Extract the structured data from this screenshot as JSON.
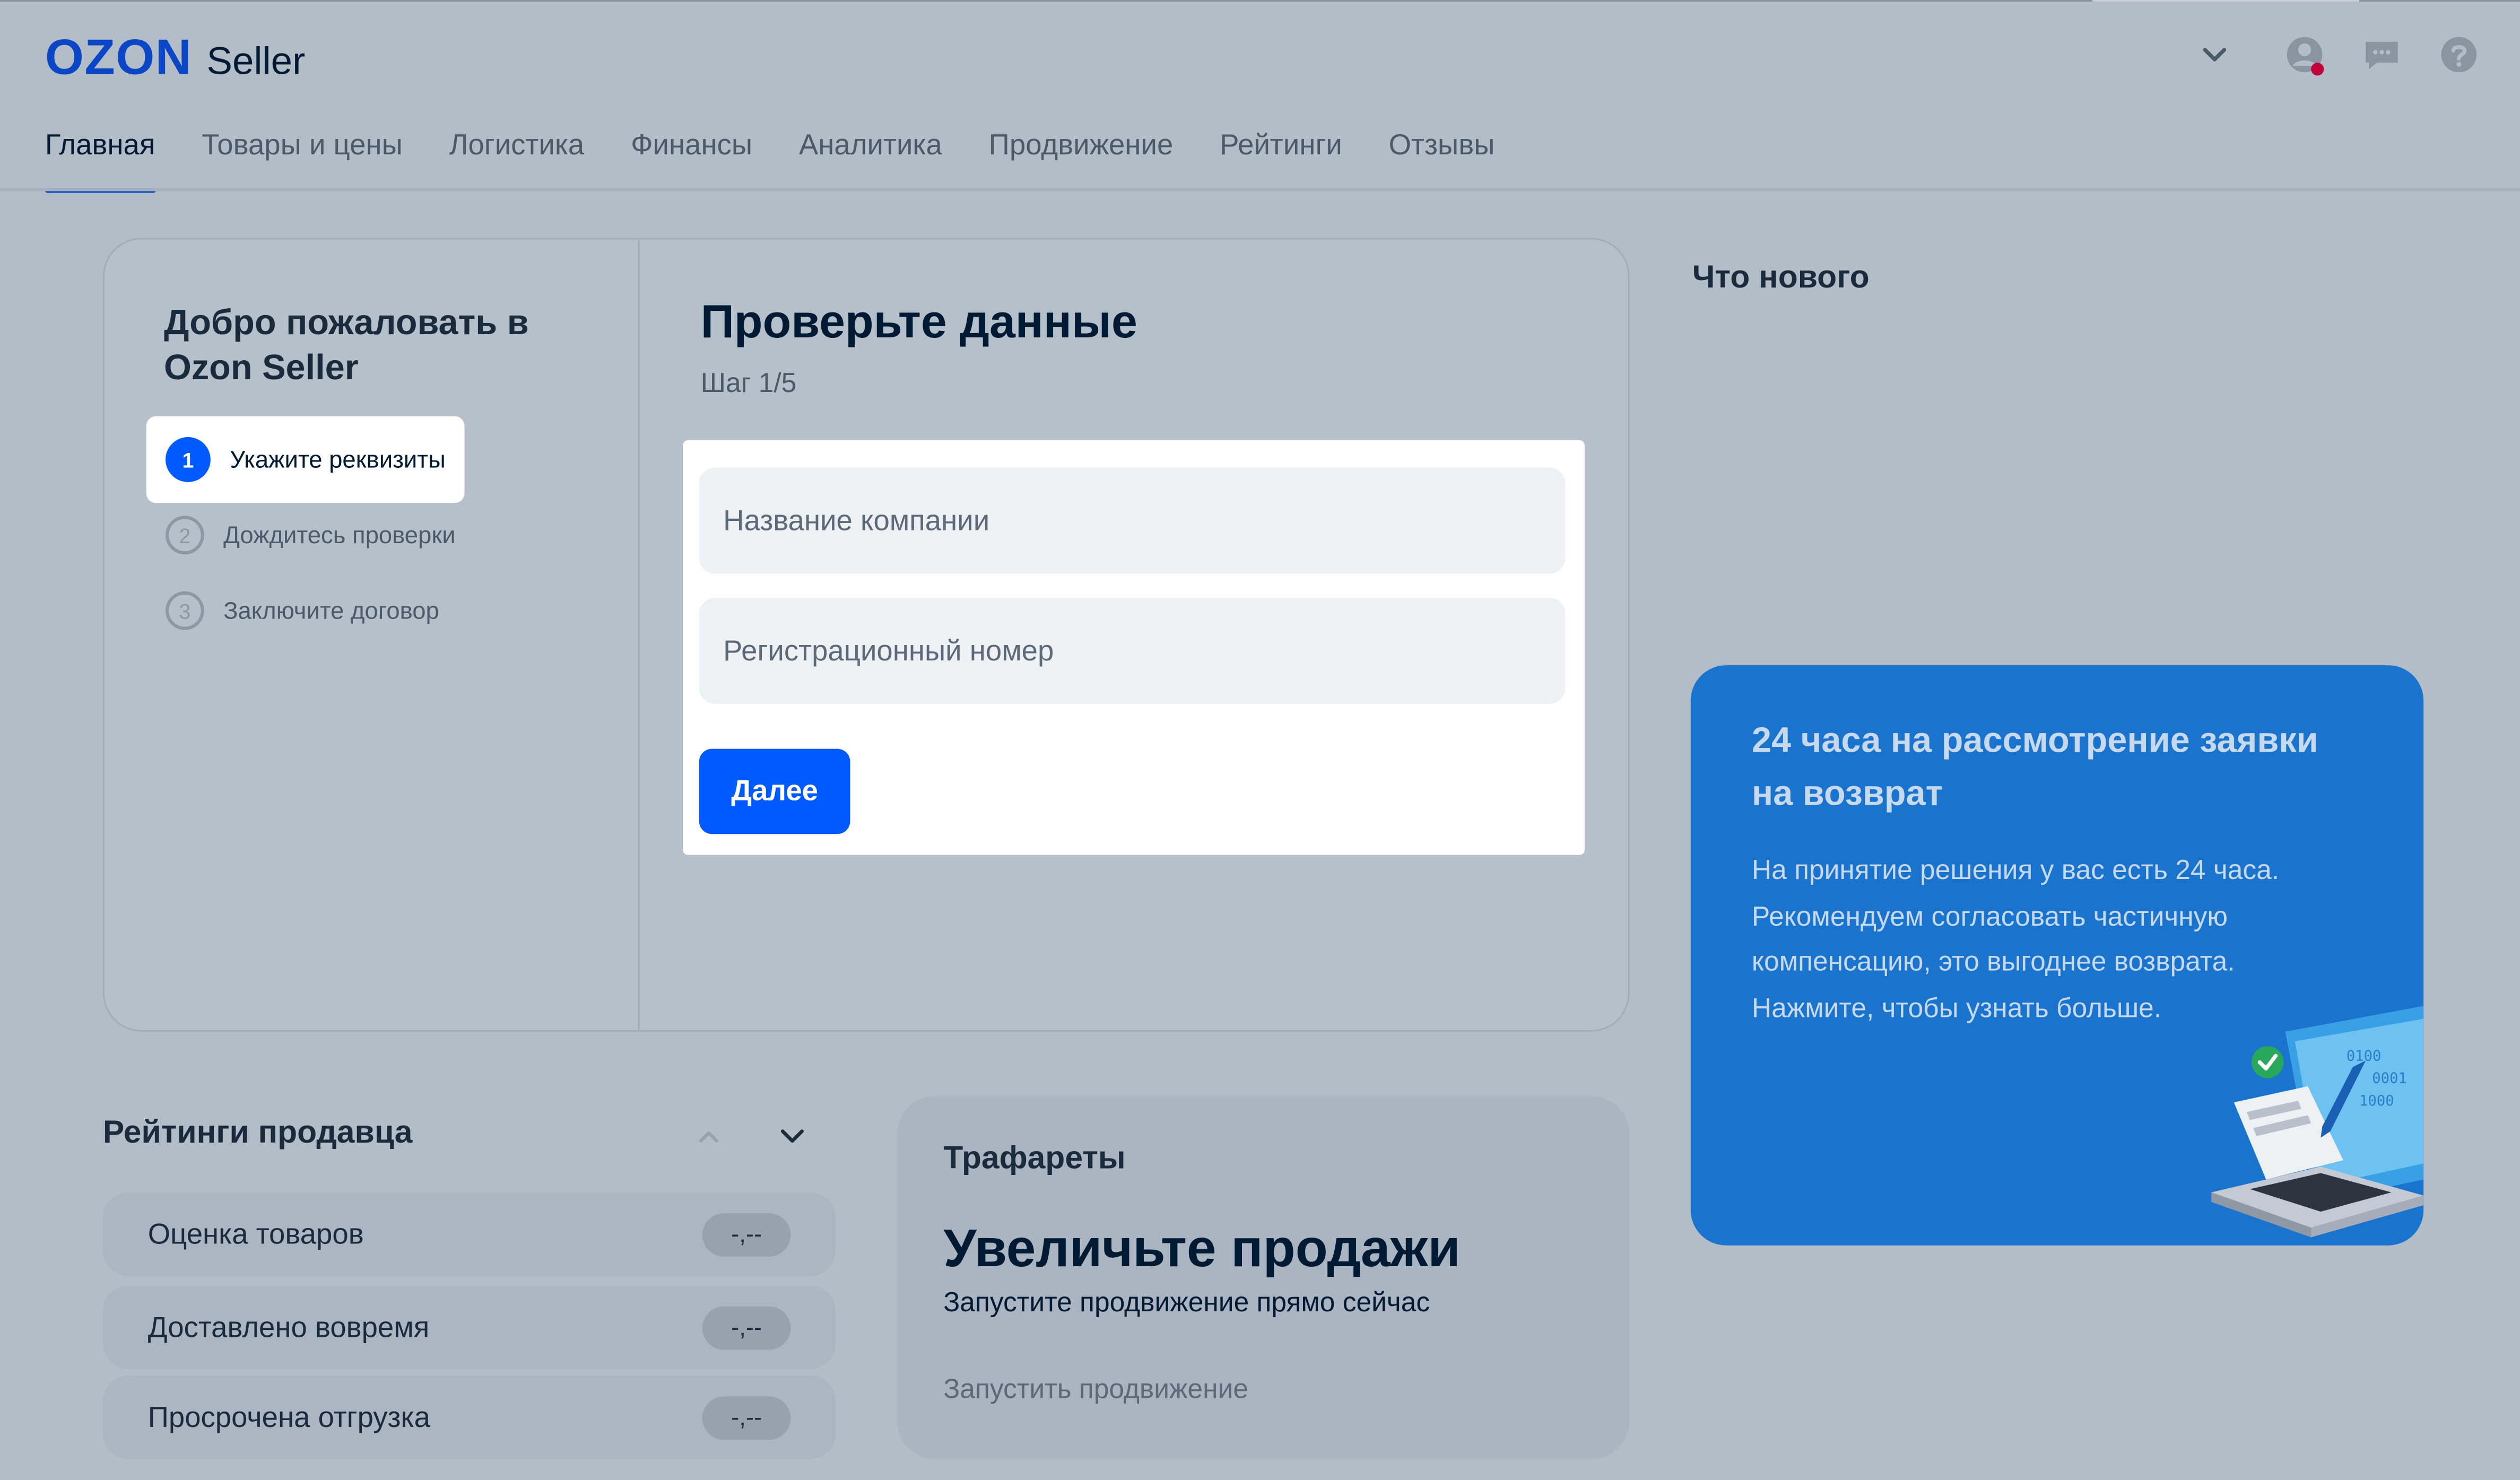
{
  "header": {
    "logo_brand": "OZON",
    "logo_product": "Seller",
    "icons": [
      "chevron-down-icon",
      "user-icon",
      "chat-icon",
      "help-icon"
    ],
    "notification_color": "#c2003b"
  },
  "tabs": [
    {
      "label": "Главная",
      "active": true
    },
    {
      "label": "Товары и цены"
    },
    {
      "label": "Логистика"
    },
    {
      "label": "Финансы"
    },
    {
      "label": "Аналитика"
    },
    {
      "label": "Продвижение"
    },
    {
      "label": "Рейтинги"
    },
    {
      "label": "Отзывы"
    }
  ],
  "onboarding": {
    "welcome": "Добро пожаловать в Ozon Seller",
    "steps": [
      {
        "num": "1",
        "label": "Укажите реквизиты",
        "active": true
      },
      {
        "num": "2",
        "label": "Дождитесь проверки"
      },
      {
        "num": "3",
        "label": "Заключите договор"
      }
    ],
    "title": "Проверьте данные",
    "step_text": "Шаг 1/5",
    "fields": {
      "company_placeholder": "Название компании",
      "reg_number_placeholder": "Регистрационный номер"
    },
    "next_label": "Далее"
  },
  "whats_new": {
    "title": "Что нового",
    "promo_title": "24 часа на рассмотрение заявки на возврат",
    "promo_text": "На принятие решения у вас есть 24 часа. Рекомендуем согласовать частичную компенсацию, это выгоднее возврата. Нажмите, чтобы узнать больше."
  },
  "ratings": {
    "title": "Рейтинги продавца",
    "rows": [
      {
        "label": "Оценка товаров",
        "value": "-,--"
      },
      {
        "label": "Доставлено вовремя",
        "value": "-,--"
      },
      {
        "label": "Просрочена отгрузка",
        "value": "-,--"
      }
    ]
  },
  "stencils": {
    "title": "Трафареты",
    "headline": "Увеличьте продажи",
    "subtitle": "Запустите продвижение прямо сейчас",
    "link": "Запустить продвижение"
  },
  "colors": {
    "accent": "#005bff",
    "brand": "#0a46c6",
    "promo_bg": "#1a73cc"
  }
}
